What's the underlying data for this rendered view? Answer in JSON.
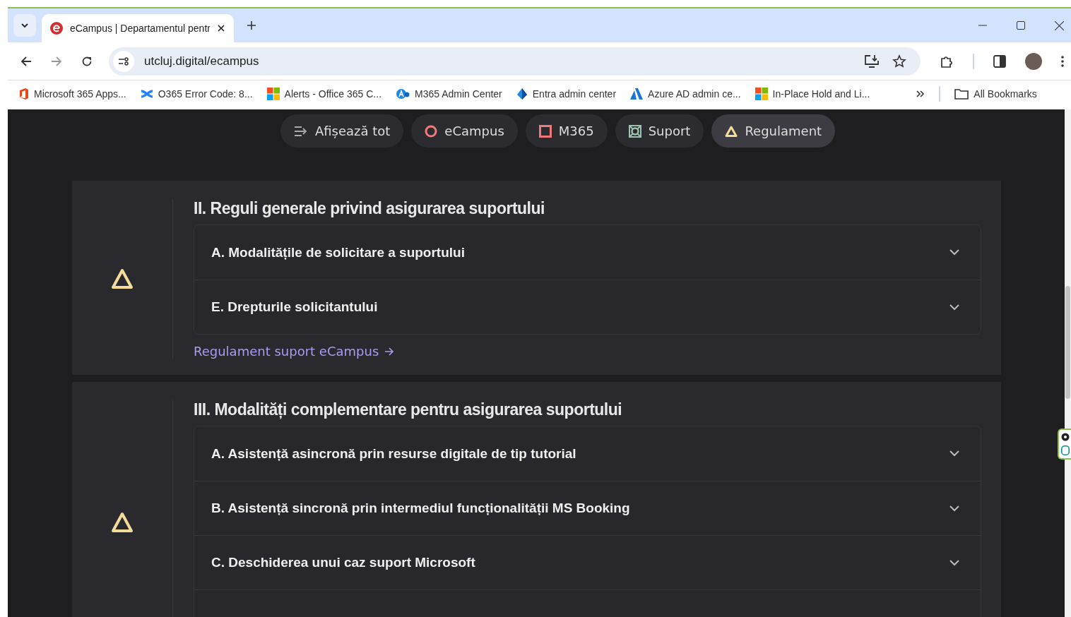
{
  "browser": {
    "tab_title": "eCampus | Departamentul pentr",
    "url": "utcluj.digital/ecampus",
    "bookmarks": [
      {
        "label": "Microsoft 365 Apps...",
        "kind": "office"
      },
      {
        "label": "O365 Error Code: 8...",
        "kind": "confluence"
      },
      {
        "label": "Alerts - Office 365 C...",
        "kind": "windows"
      },
      {
        "label": "M365 Admin Center",
        "kind": "admin"
      },
      {
        "label": "Entra admin center",
        "kind": "entra"
      },
      {
        "label": "Azure AD admin ce...",
        "kind": "azure"
      },
      {
        "label": "In-Place Hold and Li...",
        "kind": "windows"
      }
    ],
    "all_bookmarks": "All Bookmarks"
  },
  "filters": [
    {
      "label": "Afișează tot",
      "kind": "list",
      "selected": false
    },
    {
      "label": "eCampus",
      "kind": "circle",
      "selected": false
    },
    {
      "label": "M365",
      "kind": "square",
      "selected": false
    },
    {
      "label": "Suport",
      "kind": "support",
      "selected": false
    },
    {
      "label": "Regulament",
      "kind": "triangle",
      "selected": true
    }
  ],
  "sections": [
    {
      "title": "II. Reguli generale privind asigurarea suportului",
      "items": [
        {
          "label": "A. Modalitățile de solicitare a suportului",
          "expanded": false
        },
        {
          "label": "E. Drepturile solicitantului",
          "expanded": false
        }
      ],
      "link": "Regulament suport eCampus"
    },
    {
      "title": "III. Modalități complementare pentru asigurarea suportului",
      "items": [
        {
          "label": "A. Asistență asincronă prin resurse digitale de tip tutorial",
          "expanded": false
        },
        {
          "label": "B. Asistență sincronă prin intermediul funcționalității MS Booking",
          "expanded": false
        },
        {
          "label": "C. Deschiderea unui caz suport Microsoft",
          "expanded": false
        }
      ]
    }
  ]
}
